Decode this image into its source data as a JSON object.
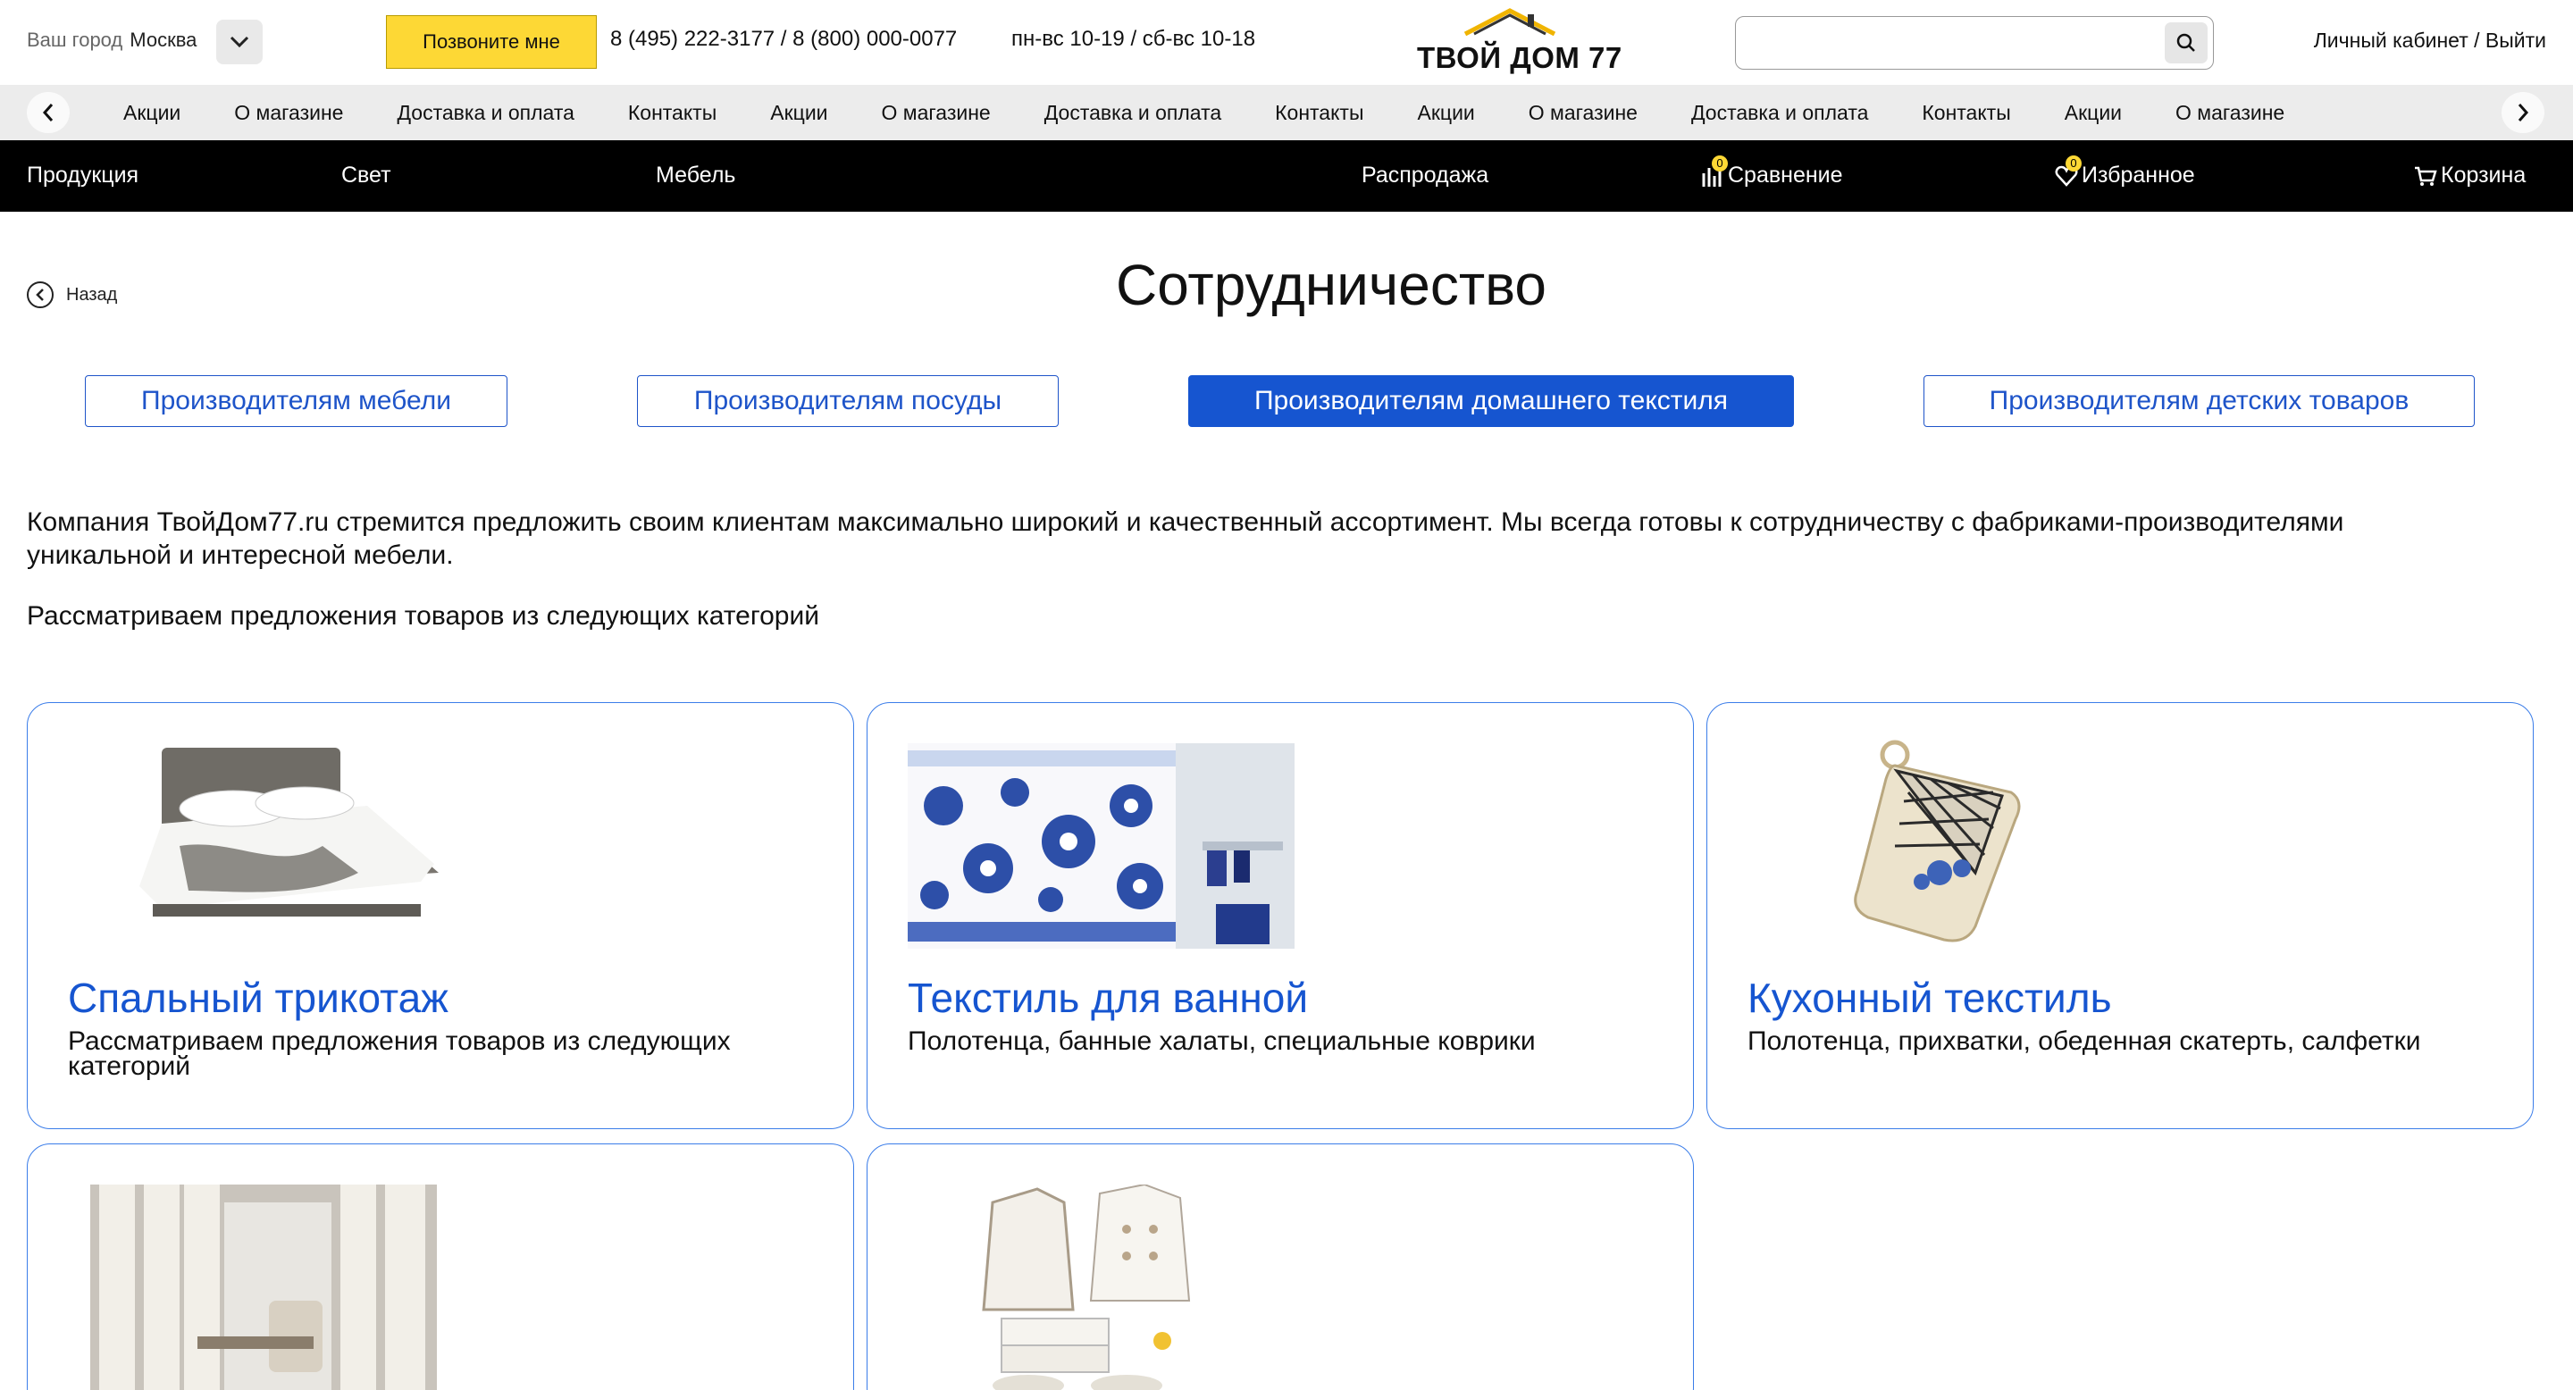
{
  "header": {
    "city_label": "Ваш город",
    "city_value": "Москва",
    "callback_label": "Позвоните мне",
    "phones": "8 (495) 222-3177 / 8 (800) 000-0077",
    "hours": "пн-вс 10-19 / сб-вс 10-18",
    "logo_text": "ТВОЙ ДОМ 77",
    "search_placeholder": "",
    "account": "Личный кабинет / Выйти"
  },
  "scroller": {
    "items": [
      "Акции",
      "О магазине",
      "Доставка и оплата",
      "Контакты",
      "Акции",
      "О магазине",
      "Доставка и оплата",
      "Контакты",
      "Акции",
      "О магазине",
      "Доставка и оплата",
      "Контакты",
      "Акции",
      "О магазине"
    ]
  },
  "nav": {
    "products": "Продукция",
    "light": "Свет",
    "furniture": "Мебель",
    "sale": "Распродажа",
    "compare": "Сравнение",
    "compare_count": "0",
    "favorites": "Избранное",
    "favorites_count": "0",
    "cart": "Корзина"
  },
  "page": {
    "back": "Назад",
    "title": "Сотрудничество",
    "tabs": [
      {
        "label": "Производителям мебели",
        "active": false
      },
      {
        "label": "Производителям посуды",
        "active": false
      },
      {
        "label": "Производителям домашнего текстиля",
        "active": true
      },
      {
        "label": "Производителям детских товаров",
        "active": false
      }
    ],
    "intro": "Компания ТвойДом77.ru стремится предложить своим клиентам максимально широкий и качественный ассортимент. Мы всегда готовы к сотрудничеству с фабриками-производителями уникальной и интересной мебели.",
    "intro2": "Рассматриваем предложения товаров из следующих категорий"
  },
  "cards": [
    {
      "title": "Спальный трикотаж",
      "desc": "Рассматриваем предложения товаров из следующих категорий",
      "image": "bed-icon"
    },
    {
      "title": "Текстиль для ванной",
      "desc": "Полотенца, банные халаты, специальные коврики",
      "image": "bath-curtain-icon"
    },
    {
      "title": "Кухонный текстиль",
      "desc": "Полотенца, прихватки, обеденная скатерть, салфетки",
      "image": "potholder-icon"
    },
    {
      "title": "",
      "desc": "",
      "image": "curtains-icon"
    },
    {
      "title": "",
      "desc": "",
      "image": "bathrobes-icon"
    }
  ],
  "colors": {
    "accent": "#1655d0",
    "callback_bg": "#fdd835",
    "nav_bg": "#000000",
    "card_border": "#3b7de9"
  }
}
